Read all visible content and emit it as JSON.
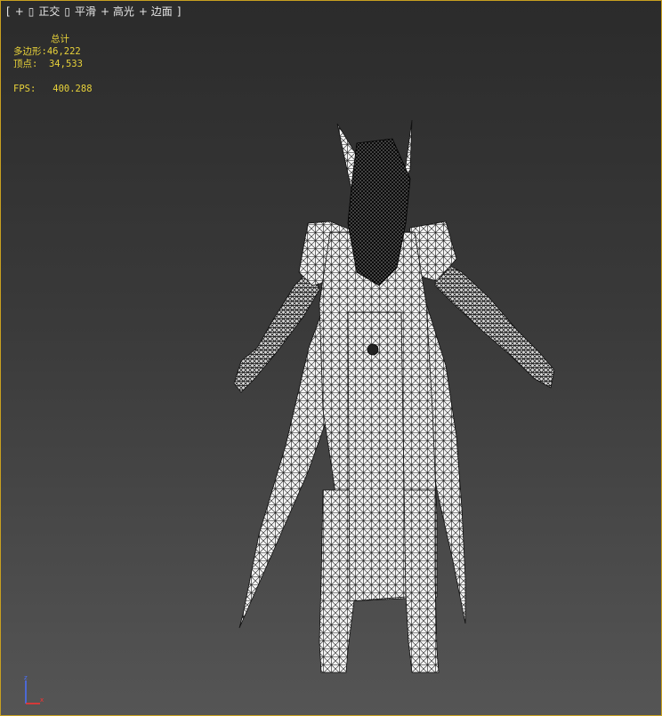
{
  "viewport": {
    "label": {
      "open_bracket": "[",
      "plus": "+",
      "view_box": "▯",
      "view": "正交",
      "shade_box": "▯",
      "shading": "平滑",
      "highlight": "+ 高光",
      "edged": "+ 边面",
      "close_bracket": "]"
    },
    "stats": {
      "title": "总计",
      "polygons_label": "多边形:",
      "polygons_value": "46,222",
      "vertices_label": "顶点:",
      "vertices_value": "34,533",
      "fps_label": "FPS:",
      "fps_value": "400.288"
    },
    "gizmo": {
      "z_label": "z",
      "x_label": "x"
    }
  },
  "colors": {
    "border": "#c8a020",
    "stats_text": "#e8d23a",
    "label_text": "#e6e6e6",
    "axis_z": "#4a70ff",
    "axis_x": "#ff3030"
  },
  "icons": {
    "model": "wireframe-character-icon",
    "gizmo": "axis-gizmo-icon"
  }
}
